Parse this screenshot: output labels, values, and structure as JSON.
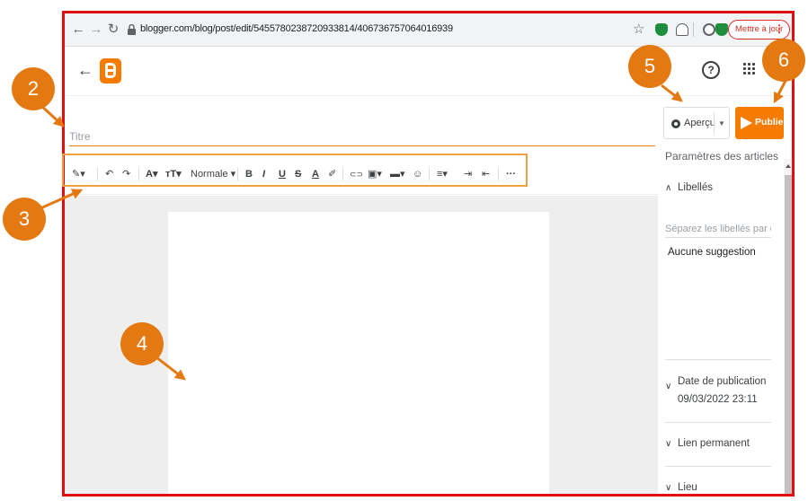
{
  "browser": {
    "url": "blogger.com/blog/post/edit/5455780238720933814/406736757064016939",
    "update_button": "Mettre à jour",
    "update_menu": "⋮"
  },
  "editor": {
    "title_placeholder": "Titre",
    "preview_label": "Aperçu",
    "publish_label": "Publier",
    "help_glyph": "?"
  },
  "toolbar": {
    "pen": "✎▾",
    "undo": "↶",
    "redo": "↷",
    "font": "A▾",
    "font_size": "тT▾",
    "paragraph_style": "Normale ▾",
    "bold": "B",
    "italic": "I",
    "underline": "U",
    "strike": "S",
    "text_color": "A",
    "highlight": "✐",
    "link": "⊂⊃",
    "image": "▣▾",
    "video": "▬▾",
    "emoji": "☺",
    "align": "≡▾",
    "indent": "⇥",
    "outdent": "⇤",
    "more": "···"
  },
  "sidebar": {
    "heading": "Paramètres des articles",
    "labels_section": "Libellés",
    "labels_placeholder": "Séparez les libellés par de...",
    "no_suggestion": "Aucune suggestion",
    "publish_date_label": "Date de publication",
    "publish_date_value": "09/03/2022 23:11",
    "permalink": "Lien permanent",
    "location": "Lieu"
  },
  "callouts": [
    "2",
    "3",
    "4",
    "5",
    "6"
  ],
  "colors": {
    "frame_border": "#e01010",
    "callout": "#e47911",
    "blogger_orange": "#f57c00"
  }
}
